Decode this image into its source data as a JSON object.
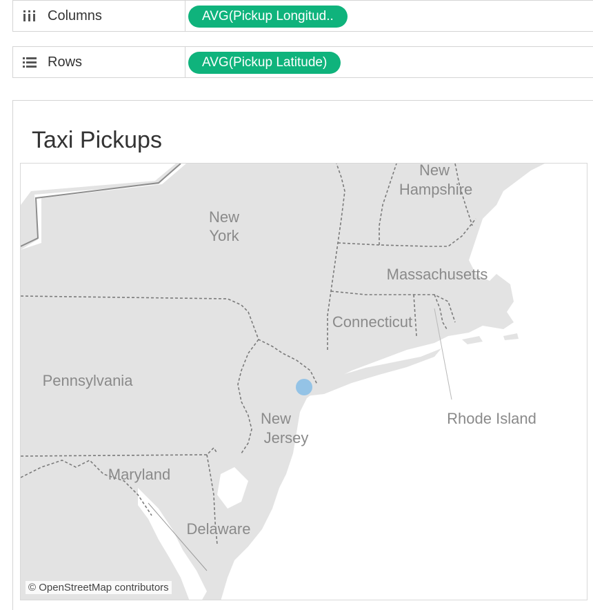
{
  "shelves": {
    "columns": {
      "label": "Columns",
      "pill": "AVG(Pickup Longitud.."
    },
    "rows": {
      "label": "Rows",
      "pill": "AVG(Pickup Latitude)"
    }
  },
  "colors": {
    "pill": "#0fb37c",
    "point": "#8fc1e6",
    "land": "#e3e3e3",
    "water": "#ffffff"
  },
  "viz": {
    "title": "Taxi Pickups"
  },
  "map": {
    "labels": {
      "new_york": [
        "New",
        "York"
      ],
      "new_hampshire": [
        "New",
        "Hampshire"
      ],
      "massachusetts": "Massachusetts",
      "connecticut": "Connecticut",
      "pennsylvania": "Pennsylvania",
      "new_jersey": [
        "New",
        "Jersey"
      ],
      "maryland": "Maryland",
      "delaware": "Delaware",
      "rhode_island": "Rhode Island"
    },
    "attribution": "© OpenStreetMap contributors"
  }
}
